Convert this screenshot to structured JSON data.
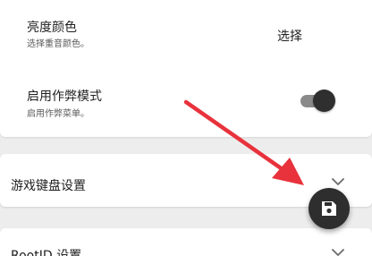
{
  "settings": {
    "brightness_color": {
      "title": "亮度颜色",
      "subtitle": "选择重音颜色。",
      "action_label": "选择"
    },
    "cheat_mode": {
      "title": "启用作弊模式",
      "subtitle": "启用作弊菜单。",
      "enabled": true
    }
  },
  "sections": {
    "game_keyboard": {
      "title": "游戏键盘设置"
    },
    "bottom_section": {
      "title": "RootID 设置"
    }
  },
  "fab": {
    "icon": "save-icon"
  },
  "annotation": {
    "color": "#e8323c"
  },
  "colors": {
    "background": "#ededed",
    "card": "#ffffff",
    "switch_thumb": "#2f2f2f",
    "switch_track": "#8a8a8a",
    "fab": "#2e2e2e"
  }
}
